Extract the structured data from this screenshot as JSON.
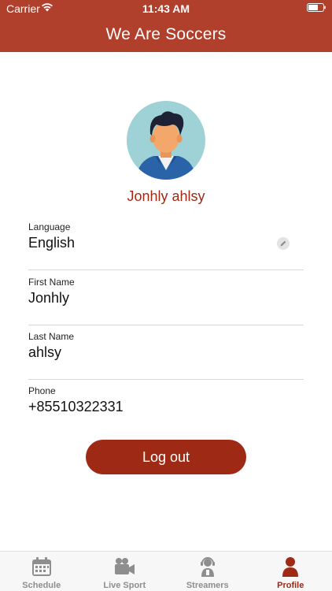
{
  "status_bar": {
    "carrier": "Carrier",
    "time": "11:43 AM"
  },
  "header": {
    "title": "We Are Soccers"
  },
  "profile": {
    "name": "Jonhly ahlsy"
  },
  "fields": {
    "language": {
      "label": "Language",
      "value": "English"
    },
    "first_name": {
      "label": "First Name",
      "value": "Jonhly"
    },
    "last_name": {
      "label": "Last Name",
      "value": "ahlsy"
    },
    "phone": {
      "label": "Phone",
      "value": "+85510322331"
    }
  },
  "logout": {
    "label": "Log out"
  },
  "tabs": [
    {
      "label": "Schedule",
      "icon": "calendar-icon",
      "active": false
    },
    {
      "label": "Live Sport",
      "icon": "video-camera-icon",
      "active": false
    },
    {
      "label": "Streamers",
      "icon": "headset-person-icon",
      "active": false
    },
    {
      "label": "Profile",
      "icon": "person-icon",
      "active": true
    }
  ],
  "colors": {
    "header": "#b03f2c",
    "accent": "#9e2a16",
    "inactive_tab": "#8e8e8e"
  }
}
